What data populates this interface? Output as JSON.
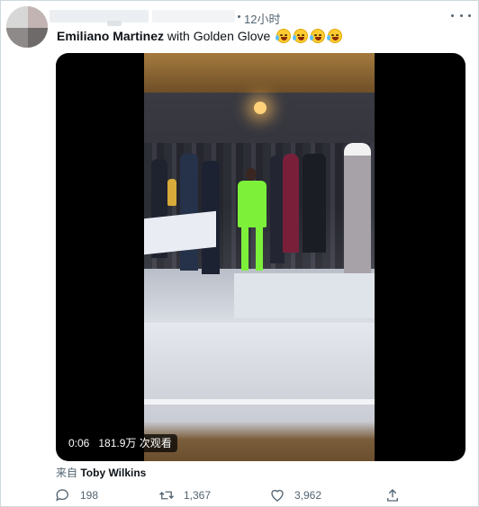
{
  "tweet": {
    "time": "12小时",
    "author_bold": "Emiliano Martinez",
    "text_rest": " with Golden Glove",
    "emoji": [
      "joy-emoji",
      "joy-emoji",
      "joy-emoji",
      "joy-emoji"
    ]
  },
  "video": {
    "duration": "0:06",
    "views": "181.9万 次观看"
  },
  "source": {
    "prefix": "来自 ",
    "name": "Toby Wilkins"
  },
  "actions": {
    "reply_count": "198",
    "retweet_count": "1,367",
    "like_count": "3,962"
  },
  "icons": {
    "reply": "reply-icon",
    "retweet": "retweet-icon",
    "like": "heart-icon",
    "share": "share-icon",
    "more": "more-options-icon"
  },
  "colors": {
    "secondary_text": "#536471",
    "primary_text": "#0f1419",
    "border": "#cfd9de"
  }
}
